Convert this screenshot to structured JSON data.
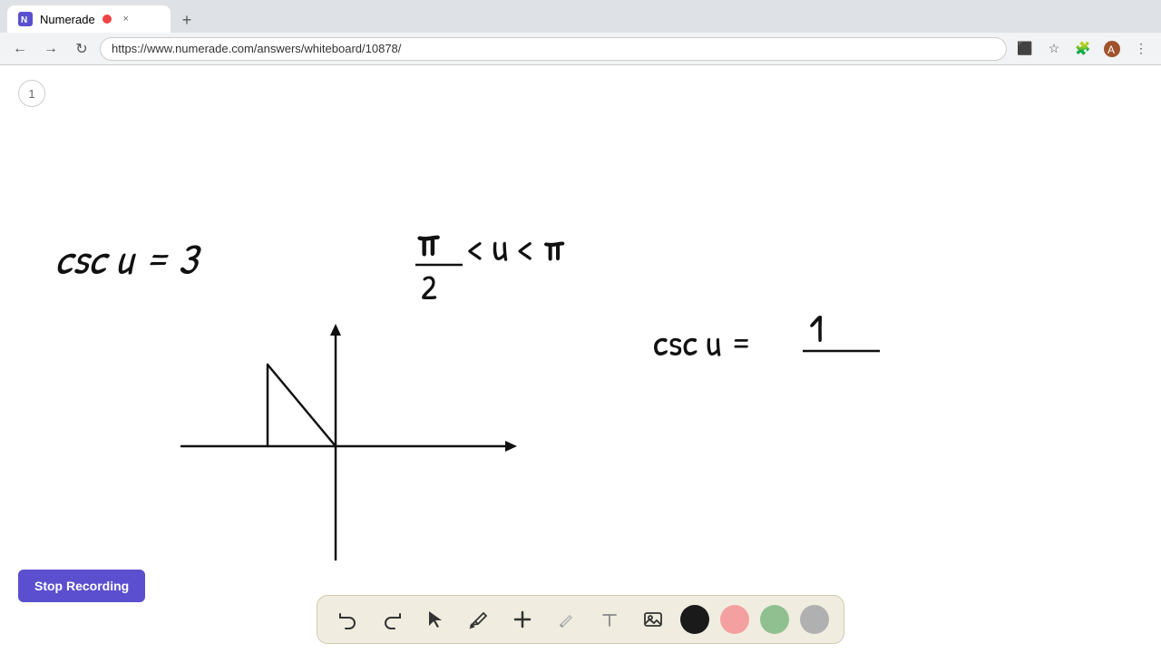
{
  "browser": {
    "title": "Numerade",
    "url": "https://www.numerade.com/answers/whiteboard/10878/",
    "tab_close": "×",
    "new_tab": "+"
  },
  "nav": {
    "back": "←",
    "forward": "→",
    "reload": "↻",
    "more": "⋮"
  },
  "page": {
    "number": "1"
  },
  "toolbar": {
    "undo": "↩",
    "redo": "↪",
    "stop_recording_label": "Stop Recording"
  },
  "colors": {
    "accent_purple": "#5b4fcf",
    "black": "#1a1a1a",
    "pink": "#f4a0a0",
    "green": "#90c090",
    "gray": "#b0b0b0"
  }
}
